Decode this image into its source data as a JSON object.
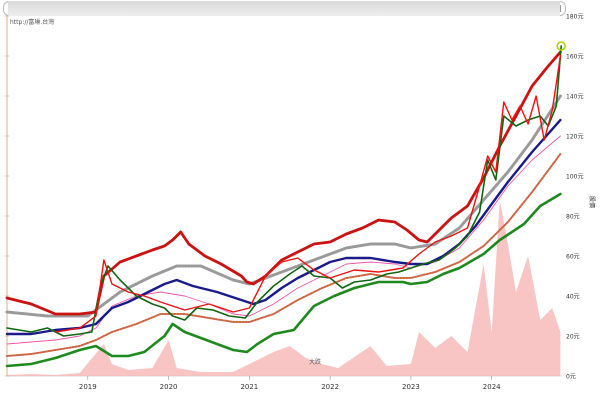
{
  "title": "",
  "source_label": "http://富琳.台灣",
  "chart_data": {
    "type": "line",
    "xlabel": "",
    "ylabel": "股價",
    "x_ticks": [
      "2019",
      "2020",
      "2021",
      "2022",
      "2023",
      "2024"
    ],
    "y_ticks": [
      "0元",
      "20元",
      "40元",
      "60元",
      "80元",
      "100元",
      "120元",
      "140元",
      "160元",
      "180元"
    ],
    "ylim": [
      0,
      180
    ],
    "annotation": "大跌",
    "grid": false,
    "series": [
      {
        "color": "#cc1111",
        "values": [
          [
            2018.0,
            39
          ],
          [
            2018.3,
            36
          ],
          [
            2018.6,
            31
          ],
          [
            2018.9,
            31
          ],
          [
            2019.1,
            32
          ],
          [
            2019.2,
            50
          ],
          [
            2019.4,
            57
          ],
          [
            2019.6,
            60
          ],
          [
            2019.8,
            63
          ],
          [
            2019.95,
            65
          ],
          [
            2020.05,
            68
          ],
          [
            2020.15,
            72
          ],
          [
            2020.25,
            66
          ],
          [
            2020.45,
            60
          ],
          [
            2020.65,
            56
          ],
          [
            2020.9,
            50
          ],
          [
            2020.97,
            47
          ],
          [
            2021.05,
            46
          ],
          [
            2021.2,
            50
          ],
          [
            2021.4,
            58
          ],
          [
            2021.6,
            62
          ],
          [
            2021.8,
            66
          ],
          [
            2022.0,
            67
          ],
          [
            2022.2,
            71
          ],
          [
            2022.4,
            74
          ],
          [
            2022.6,
            78
          ],
          [
            2022.8,
            77
          ],
          [
            2022.95,
            73
          ],
          [
            2023.1,
            68
          ],
          [
            2023.2,
            67
          ],
          [
            2023.3,
            71
          ],
          [
            2023.5,
            79
          ],
          [
            2023.7,
            85
          ],
          [
            2023.9,
            99
          ],
          [
            2024.1,
            115
          ],
          [
            2024.3,
            130
          ],
          [
            2024.5,
            145
          ],
          [
            2024.7,
            155
          ],
          [
            2024.85,
            162
          ]
        ]
      },
      {
        "color": "#1a1a8a",
        "values": [
          [
            2018.0,
            21
          ],
          [
            2018.3,
            21
          ],
          [
            2018.6,
            23
          ],
          [
            2018.9,
            24
          ],
          [
            2019.1,
            26
          ],
          [
            2019.3,
            34
          ],
          [
            2019.5,
            37
          ],
          [
            2019.7,
            41
          ],
          [
            2019.95,
            46
          ],
          [
            2020.1,
            48
          ],
          [
            2020.3,
            45
          ],
          [
            2020.6,
            42
          ],
          [
            2020.9,
            38
          ],
          [
            2021.05,
            36
          ],
          [
            2021.2,
            38
          ],
          [
            2021.4,
            44
          ],
          [
            2021.6,
            49
          ],
          [
            2021.8,
            53
          ],
          [
            2022.0,
            57
          ],
          [
            2022.2,
            59
          ],
          [
            2022.5,
            59
          ],
          [
            2022.8,
            57
          ],
          [
            2023.0,
            56
          ],
          [
            2023.2,
            56
          ],
          [
            2023.4,
            60
          ],
          [
            2023.6,
            66
          ],
          [
            2023.8,
            75
          ],
          [
            2024.0,
            86
          ],
          [
            2024.2,
            97
          ],
          [
            2024.5,
            112
          ],
          [
            2024.85,
            128
          ]
        ]
      },
      {
        "color": "#ee55aa",
        "values": [
          [
            2018.0,
            16
          ],
          [
            2018.3,
            17
          ],
          [
            2018.6,
            18
          ],
          [
            2018.9,
            20
          ],
          [
            2019.1,
            24
          ],
          [
            2019.3,
            35
          ],
          [
            2019.6,
            40
          ],
          [
            2019.9,
            42
          ],
          [
            2020.2,
            40
          ],
          [
            2020.5,
            36
          ],
          [
            2020.8,
            31
          ],
          [
            2021.0,
            30
          ],
          [
            2021.3,
            36
          ],
          [
            2021.6,
            44
          ],
          [
            2021.9,
            50
          ],
          [
            2022.2,
            56
          ],
          [
            2022.5,
            57
          ],
          [
            2022.8,
            56
          ],
          [
            2023.0,
            54
          ],
          [
            2023.3,
            57
          ],
          [
            2023.6,
            64
          ],
          [
            2023.9,
            78
          ],
          [
            2024.2,
            95
          ],
          [
            2024.5,
            108
          ],
          [
            2024.85,
            120
          ]
        ]
      },
      {
        "color": "#cc6644",
        "values": [
          [
            2018.0,
            10
          ],
          [
            2018.3,
            11
          ],
          [
            2018.6,
            13
          ],
          [
            2018.9,
            15
          ],
          [
            2019.1,
            18
          ],
          [
            2019.3,
            22
          ],
          [
            2019.6,
            26
          ],
          [
            2019.9,
            31
          ],
          [
            2020.2,
            31
          ],
          [
            2020.5,
            29
          ],
          [
            2020.8,
            27
          ],
          [
            2021.0,
            27
          ],
          [
            2021.3,
            31
          ],
          [
            2021.6,
            38
          ],
          [
            2021.9,
            44
          ],
          [
            2022.2,
            49
          ],
          [
            2022.5,
            51
          ],
          [
            2022.8,
            49
          ],
          [
            2023.0,
            49
          ],
          [
            2023.3,
            52
          ],
          [
            2023.6,
            57
          ],
          [
            2023.9,
            65
          ],
          [
            2024.2,
            77
          ],
          [
            2024.5,
            92
          ],
          [
            2024.85,
            111
          ]
        ]
      },
      {
        "color": "#1e8a1e",
        "values": [
          [
            2018.0,
            5
          ],
          [
            2018.3,
            6
          ],
          [
            2018.6,
            9
          ],
          [
            2018.9,
            13
          ],
          [
            2019.1,
            15
          ],
          [
            2019.3,
            10
          ],
          [
            2019.5,
            10
          ],
          [
            2019.7,
            12
          ],
          [
            2019.95,
            20
          ],
          [
            2020.05,
            26
          ],
          [
            2020.2,
            22
          ],
          [
            2020.4,
            19
          ],
          [
            2020.6,
            16
          ],
          [
            2020.8,
            13
          ],
          [
            2020.97,
            12
          ],
          [
            2021.1,
            16
          ],
          [
            2021.3,
            21
          ],
          [
            2021.55,
            23
          ],
          [
            2021.8,
            35
          ],
          [
            2022.05,
            40
          ],
          [
            2022.3,
            44
          ],
          [
            2022.6,
            47
          ],
          [
            2022.9,
            47
          ],
          [
            2023.0,
            46
          ],
          [
            2023.2,
            47
          ],
          [
            2023.4,
            51
          ],
          [
            2023.6,
            54
          ],
          [
            2023.9,
            61
          ],
          [
            2024.1,
            68
          ],
          [
            2024.4,
            76
          ],
          [
            2024.6,
            85
          ],
          [
            2024.85,
            91
          ]
        ]
      },
      {
        "color": "#9a9a9a",
        "values": [
          [
            2018.0,
            32
          ],
          [
            2018.5,
            30
          ],
          [
            2019.0,
            30
          ],
          [
            2019.4,
            42
          ],
          [
            2019.8,
            50
          ],
          [
            2020.1,
            55
          ],
          [
            2020.4,
            55
          ],
          [
            2020.8,
            48
          ],
          [
            2021.0,
            46
          ],
          [
            2021.4,
            52
          ],
          [
            2021.8,
            58
          ],
          [
            2022.2,
            64
          ],
          [
            2022.5,
            66
          ],
          [
            2022.8,
            66
          ],
          [
            2023.0,
            64
          ],
          [
            2023.3,
            66
          ],
          [
            2023.6,
            74
          ],
          [
            2023.9,
            88
          ],
          [
            2024.2,
            102
          ],
          [
            2024.5,
            118
          ],
          [
            2024.85,
            140
          ]
        ]
      },
      {
        "color": "#116611",
        "values": [
          [
            2018.0,
            24
          ],
          [
            2018.3,
            22
          ],
          [
            2018.5,
            24
          ],
          [
            2018.7,
            20
          ],
          [
            2018.9,
            21
          ],
          [
            2019.05,
            22
          ],
          [
            2019.15,
            44
          ],
          [
            2019.25,
            55
          ],
          [
            2019.4,
            48
          ],
          [
            2019.6,
            40
          ],
          [
            2019.8,
            36
          ],
          [
            2019.95,
            34
          ],
          [
            2020.05,
            30
          ],
          [
            2020.2,
            28
          ],
          [
            2020.35,
            34
          ],
          [
            2020.55,
            33
          ],
          [
            2020.75,
            30
          ],
          [
            2020.95,
            29
          ],
          [
            2021.1,
            37
          ],
          [
            2021.3,
            45
          ],
          [
            2021.5,
            51
          ],
          [
            2021.65,
            55
          ],
          [
            2021.8,
            50
          ],
          [
            2022.0,
            49
          ],
          [
            2022.15,
            44
          ],
          [
            2022.3,
            47
          ],
          [
            2022.5,
            48
          ],
          [
            2022.7,
            51
          ],
          [
            2022.85,
            52
          ],
          [
            2023.0,
            54
          ],
          [
            2023.15,
            56
          ],
          [
            2023.35,
            58
          ],
          [
            2023.55,
            64
          ],
          [
            2023.7,
            70
          ],
          [
            2023.85,
            82
          ],
          [
            2023.95,
            108
          ],
          [
            2024.05,
            98
          ],
          [
            2024.15,
            130
          ],
          [
            2024.3,
            125
          ],
          [
            2024.45,
            128
          ],
          [
            2024.6,
            130
          ],
          [
            2024.7,
            125
          ],
          [
            2024.8,
            135
          ],
          [
            2024.86,
            165
          ]
        ]
      },
      {
        "color": "#ee1111",
        "values": [
          [
            2018.6,
            22
          ],
          [
            2018.9,
            24
          ],
          [
            2019.1,
            30
          ],
          [
            2019.2,
            58
          ],
          [
            2019.3,
            46
          ],
          [
            2019.5,
            42
          ],
          [
            2019.7,
            40
          ],
          [
            2019.9,
            37
          ],
          [
            2020.2,
            33
          ],
          [
            2020.5,
            36
          ],
          [
            2020.8,
            32
          ],
          [
            2021.0,
            34
          ],
          [
            2021.2,
            50
          ],
          [
            2021.4,
            57
          ],
          [
            2021.6,
            59
          ],
          [
            2021.8,
            53
          ],
          [
            2022.0,
            49
          ],
          [
            2022.3,
            53
          ],
          [
            2022.6,
            52
          ],
          [
            2022.9,
            54
          ],
          [
            2023.1,
            61
          ],
          [
            2023.3,
            67
          ],
          [
            2023.5,
            70
          ],
          [
            2023.7,
            74
          ],
          [
            2023.85,
            95
          ],
          [
            2023.95,
            110
          ],
          [
            2024.05,
            102
          ],
          [
            2024.15,
            137
          ],
          [
            2024.25,
            128
          ],
          [
            2024.35,
            135
          ],
          [
            2024.45,
            126
          ],
          [
            2024.55,
            140
          ],
          [
            2024.65,
            118
          ],
          [
            2024.75,
            133
          ],
          [
            2024.85,
            160
          ]
        ]
      },
      {
        "color": "#f7b0b0",
        "values": [
          [
            2018.0,
            0.5
          ],
          [
            2018.3,
            1
          ],
          [
            2018.6,
            0.5
          ],
          [
            2018.9,
            1.5
          ],
          [
            2019.2,
            16
          ],
          [
            2019.3,
            6
          ],
          [
            2019.5,
            3
          ],
          [
            2019.8,
            4
          ],
          [
            2020.0,
            18
          ],
          [
            2020.1,
            4
          ],
          [
            2020.4,
            2
          ],
          [
            2020.8,
            2
          ],
          [
            2021.1,
            8
          ],
          [
            2021.3,
            12
          ],
          [
            2021.5,
            15
          ],
          [
            2021.7,
            9
          ],
          [
            2021.9,
            6
          ],
          [
            2022.1,
            4
          ],
          [
            2022.5,
            15
          ],
          [
            2022.7,
            5
          ],
          [
            2023.0,
            6
          ],
          [
            2023.1,
            22
          ],
          [
            2023.3,
            14
          ],
          [
            2023.5,
            20
          ],
          [
            2023.7,
            12
          ],
          [
            2023.9,
            56
          ],
          [
            2024.0,
            22
          ],
          [
            2024.1,
            88
          ],
          [
            2024.2,
            66
          ],
          [
            2024.3,
            42
          ],
          [
            2024.45,
            60
          ],
          [
            2024.6,
            28
          ],
          [
            2024.75,
            34
          ],
          [
            2024.85,
            22
          ]
        ]
      }
    ]
  }
}
